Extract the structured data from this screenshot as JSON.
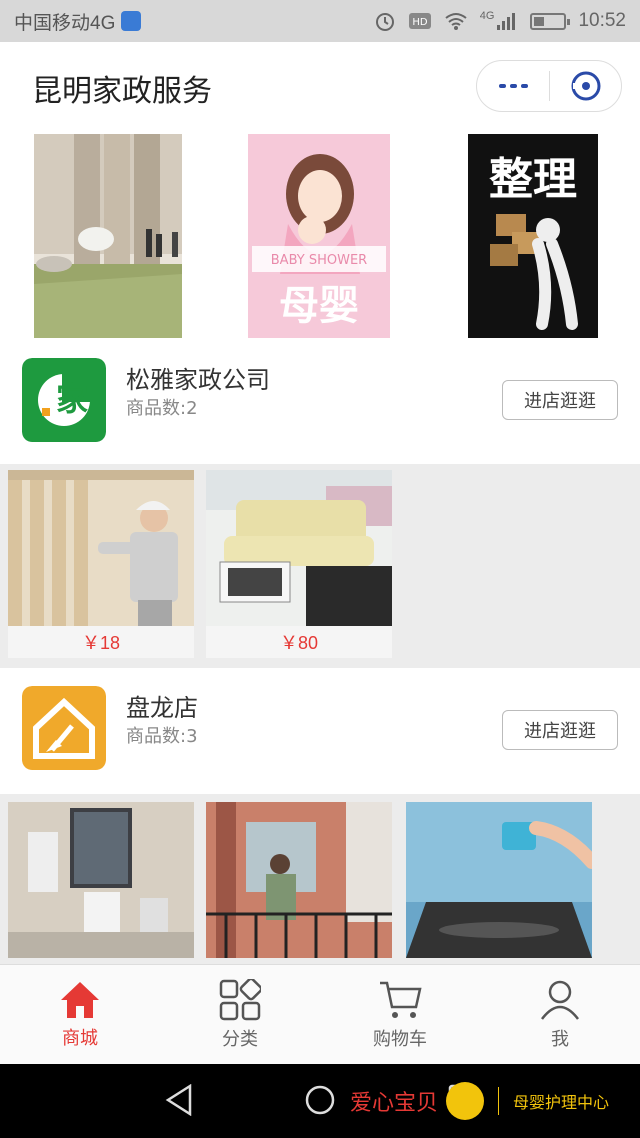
{
  "status_bar": {
    "carrier": "中国移动4G",
    "signal_label": "4G",
    "time": "10:52",
    "battery_level": 0.35
  },
  "header": {
    "title": "昆明家政服务"
  },
  "banners": [
    {
      "name": "banner-interior"
    },
    {
      "name": "banner-baby-shower",
      "label": "BABY SHOWER",
      "big_text": "母婴"
    },
    {
      "name": "banner-organize",
      "big_text": "整理"
    }
  ],
  "stores": [
    {
      "name": "松雅家政公司",
      "count_text": "商品数:2",
      "button_label": "进店逛逛",
      "logo_text": "家",
      "logo_color": "#1e9a3f",
      "products": [
        {
          "price": "￥18"
        },
        {
          "price": "￥80"
        }
      ]
    },
    {
      "name": "盘龙店",
      "count_text": "商品数:3",
      "button_label": "进店逛逛",
      "logo_color": "#f0a92b",
      "products": [
        {
          "price": ""
        },
        {
          "price": ""
        },
        {
          "price": ""
        }
      ]
    }
  ],
  "tabbar": {
    "items": [
      {
        "label": "商城",
        "icon": "home-icon",
        "active": true
      },
      {
        "label": "分类",
        "icon": "grid-icon",
        "active": false
      },
      {
        "label": "购物车",
        "icon": "cart-icon",
        "active": false
      },
      {
        "label": "我",
        "icon": "user-icon",
        "active": false
      }
    ]
  },
  "watermark": {
    "left_text": "爱心宝贝",
    "right_text": "母婴护理中心"
  },
  "colors": {
    "accent": "#e53935",
    "store1_logo": "#1e9a3f",
    "store2_logo": "#f0a92b"
  }
}
